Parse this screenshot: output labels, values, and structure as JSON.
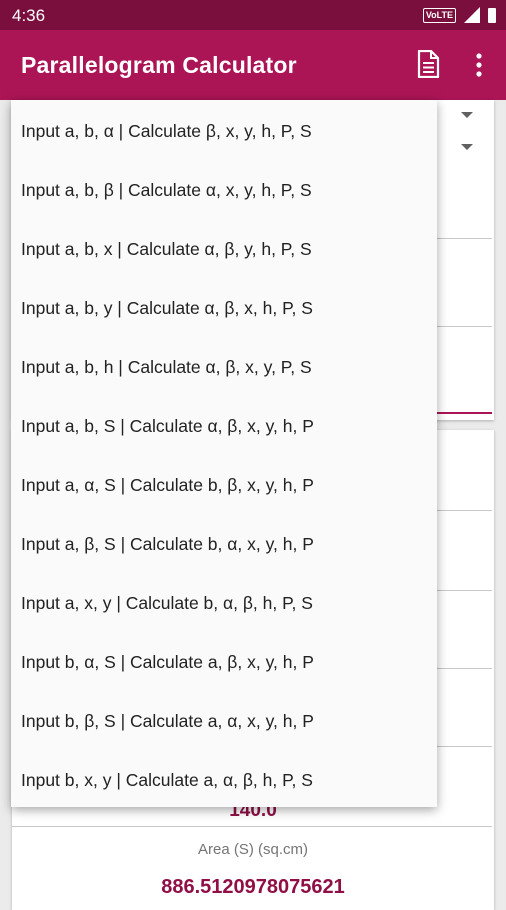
{
  "status_bar": {
    "time": "4:36",
    "volte": "VoLTE"
  },
  "app_bar": {
    "title": "Parallelogram Calculator"
  },
  "results": {
    "perimeter_value": "140.0",
    "area_label": "Area (S) (sq.cm)",
    "area_value": "886.5120978075621"
  },
  "colors": {
    "primary": "#ab1556",
    "primary_dark": "#7a0e3d",
    "value_text": "#8f0f46"
  },
  "dropdown": {
    "items": [
      "Input a, b, α | Calculate β, x, y, h, P, S",
      "Input a, b, β | Calculate α, x, y, h, P, S",
      "Input a, b, x | Calculate α, β, y, h, P, S",
      "Input a, b, y | Calculate α, β, x, h, P, S",
      "Input a, b, h | Calculate α, β, x, y, P, S",
      "Input a, b, S | Calculate α, β, x, y, h, P",
      "Input a, α, S | Calculate b, β, x, y, h, P",
      "Input a, β, S | Calculate b, α, x, y, h, P",
      "Input a, x, y | Calculate b, α, β, h, P, S",
      "Input b, α, S | Calculate a, β, x, y, h, P",
      "Input b, β, S | Calculate a, α, x, y, h, P",
      "Input b, x, y | Calculate a, α, β, h, P, S"
    ]
  }
}
